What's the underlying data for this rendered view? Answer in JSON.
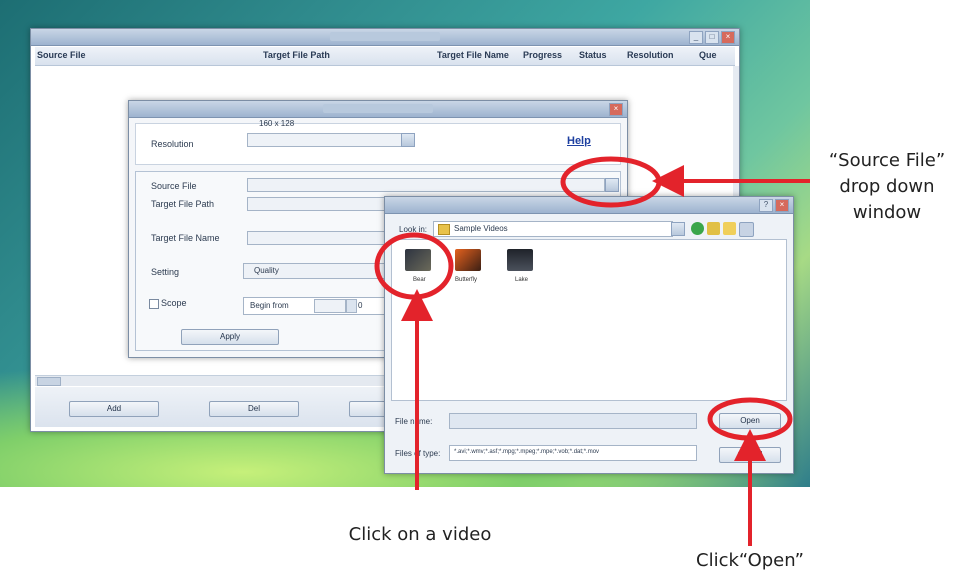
{
  "main_window": {
    "columns": [
      "Source File",
      "Target File Path",
      "Target File Name",
      "Progress",
      "Status",
      "Resolution",
      "Que"
    ],
    "buttons": {
      "add": "Add",
      "second": "Del"
    }
  },
  "settings_dialog": {
    "resolution_label": "Resolution",
    "resolution_value": "160 x 128",
    "help_link": "Help",
    "source_file_label": "Source File",
    "target_path_label": "Target File Path",
    "target_name_label": "Target File Name",
    "setting_label": "Setting",
    "setting_value": "Quality",
    "scope_label": "Scope",
    "begin_from_label": "Begin from",
    "begin_value": "0",
    "apply_button": "Apply"
  },
  "open_dialog": {
    "look_in_label": "Look in:",
    "look_in_value": "Sample Videos",
    "files": [
      {
        "name": "Bear",
        "color": "#3a3f48"
      },
      {
        "name": "Butterfly",
        "color": "#c2461e"
      },
      {
        "name": "Lake",
        "color": "#2b2f36"
      }
    ],
    "file_name_label": "File name:",
    "file_type_label": "Files of type:",
    "file_type_value": "*.avi;*.wmv;*.asf;*.mpg;*.mpeg;*.mpe;*.vob;*.dat;*.mov",
    "open_button": "Open",
    "cancel_button": "Cancel"
  },
  "annotations": {
    "source_line1": "“Source File”",
    "source_line2": "drop down",
    "source_line3": "window",
    "video": "Click on a video",
    "open": "Click“Open”",
    "color": "#e3232b"
  }
}
